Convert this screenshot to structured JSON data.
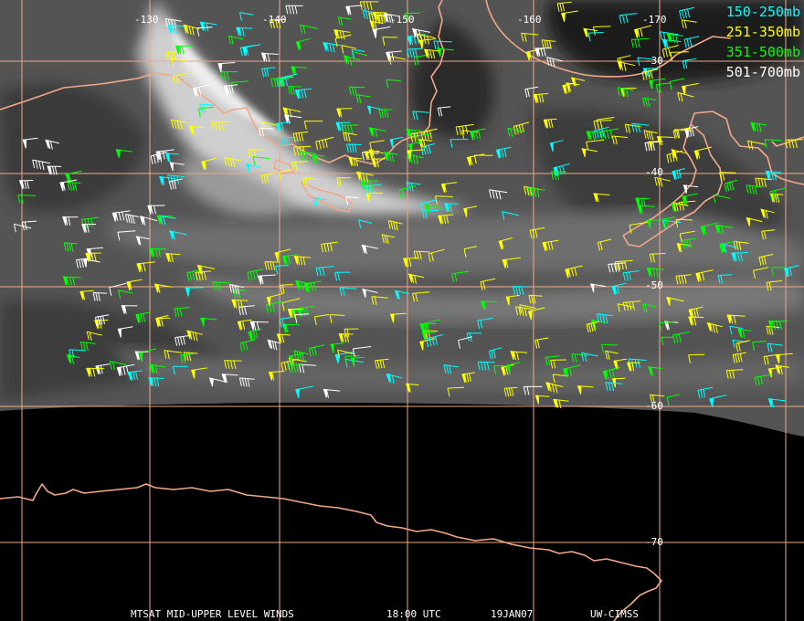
{
  "colors": {
    "grid": "#f0a888",
    "coast": "#f0a888",
    "band_150_250": "#00ffff",
    "band_251_350": "#ffff00",
    "band_351_500": "#00ff00",
    "band_501_700": "#ffffff",
    "ocean_dark": "#2a2a2a",
    "cloud_light": "#bdbdbd",
    "no_data": "#000000"
  },
  "map": {
    "longitude_labels": [
      "-130",
      "-140",
      "-150",
      "-160",
      "-170"
    ],
    "latitude_labels": [
      "-30",
      "-40",
      "-50",
      "-60",
      "-70"
    ]
  },
  "legend": [
    {
      "label": "150-250mb",
      "color_key": "band_150_250"
    },
    {
      "label": "251-350mb",
      "color_key": "band_251_350"
    },
    {
      "label": "351-500mb",
      "color_key": "band_351_500"
    },
    {
      "label": "501-700mb",
      "color_key": "band_501_700"
    }
  ],
  "footer": {
    "product": "MTSAT MID-UPPER LEVEL WINDS",
    "time": "18:00 UTC",
    "date": "19JAN07",
    "source": "UW-CIMSS"
  }
}
